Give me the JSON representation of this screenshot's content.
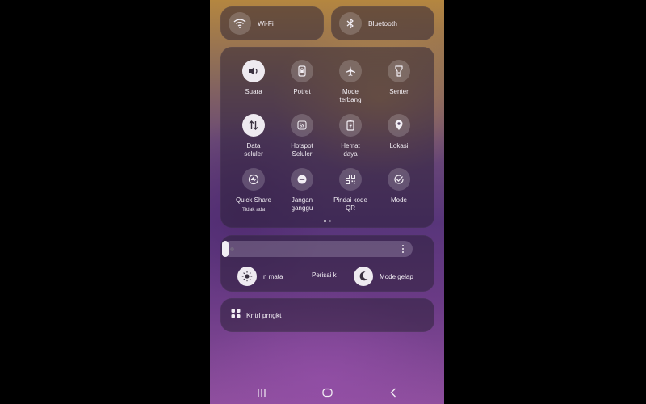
{
  "top_toggles": {
    "wifi": {
      "label": "Wi-Fi",
      "icon": "wifi-icon",
      "state": "off"
    },
    "bluetooth": {
      "label": "Bluetooth",
      "icon": "bluetooth-icon",
      "state": "off"
    }
  },
  "tiles": [
    {
      "label": "Suara",
      "icon": "speaker-icon",
      "state": "on"
    },
    {
      "label": "Potret",
      "icon": "portrait-lock-icon",
      "state": "off"
    },
    {
      "label": "Mode\nterbang",
      "icon": "airplane-icon",
      "state": "off"
    },
    {
      "label": "Senter",
      "icon": "flashlight-icon",
      "state": "off"
    },
    {
      "label": "Data\nseluler",
      "icon": "data-arrows-icon",
      "state": "on"
    },
    {
      "label": "Hotspot\nSeluler",
      "icon": "hotspot-icon",
      "state": "off"
    },
    {
      "label": "Hemat\ndaya",
      "icon": "battery-saver-icon",
      "state": "off"
    },
    {
      "label": "Lokasi",
      "icon": "location-pin-icon",
      "state": "off"
    },
    {
      "label": "Quick Share",
      "sub": "Tidak ada",
      "icon": "quick-share-icon",
      "state": "off"
    },
    {
      "label": "Jangan\nganggu",
      "icon": "do-not-disturb-icon",
      "state": "off"
    },
    {
      "label": "Pindai kode\nQR",
      "icon": "qr-scan-icon",
      "state": "off"
    },
    {
      "label": "Mode",
      "icon": "mode-check-icon",
      "state": "off"
    }
  ],
  "pager": {
    "pages": 2,
    "current": 1
  },
  "brightness": {
    "level": 0.03
  },
  "display_toggles": {
    "eye_comfort": {
      "label": "n mata",
      "icon": "sun-icon"
    },
    "shield": {
      "label": "Perisai k"
    },
    "dark_mode": {
      "label": "Mode gelap",
      "icon": "moon-icon"
    }
  },
  "device_control": {
    "label": "Kntrl prngkt",
    "icon": "grid-icon"
  },
  "nav_bar": {
    "recents": "recents-icon",
    "home": "home-icon",
    "back": "back-icon"
  },
  "colors": {
    "tile_on_bg": "#eeeaf0",
    "text": "#f2eef4",
    "card_bg": "rgba(42,32,54,0.52)"
  }
}
